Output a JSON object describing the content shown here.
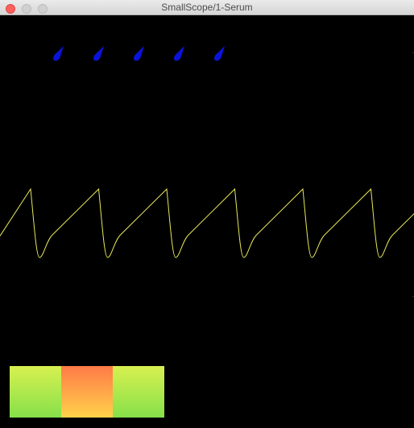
{
  "window": {
    "title": "SmallScope/1-Serum"
  },
  "colors": {
    "background": "#000000",
    "trace": "#e8e85a",
    "knob": "#0a14d8"
  },
  "knobs": [
    {
      "icon": "knob-icon"
    },
    {
      "icon": "knob-icon"
    },
    {
      "icon": "knob-icon"
    },
    {
      "icon": "knob-icon"
    },
    {
      "icon": "knob-icon"
    }
  ],
  "waveform": {
    "shape": "sawtooth",
    "cycles_visible": 6
  },
  "color_blocks": [
    {
      "top": "#d8f050",
      "bottom": "#86e04a"
    },
    {
      "top": "#ff7a48",
      "bottom": "#ffd24a"
    },
    {
      "top": "#d8f050",
      "bottom": "#86e04a"
    }
  ]
}
